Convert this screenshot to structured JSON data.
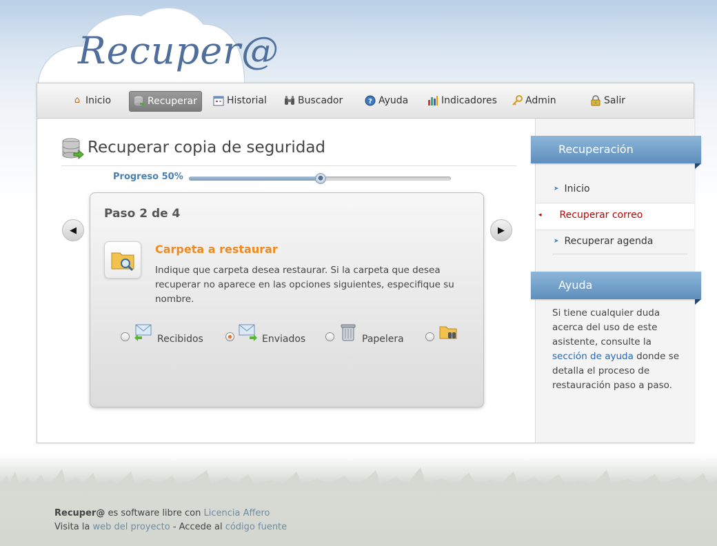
{
  "app": {
    "logo": "Recuper@"
  },
  "nav": {
    "items": [
      {
        "label": "Inicio",
        "icon": "home-icon"
      },
      {
        "label": "Recuperar",
        "icon": "database-icon"
      },
      {
        "label": "Historial",
        "icon": "calendar-icon"
      },
      {
        "label": "Buscador",
        "icon": "binoculars-icon"
      },
      {
        "label": "Ayuda",
        "icon": "help-icon"
      },
      {
        "label": "Indicadores",
        "icon": "bar-chart-icon"
      },
      {
        "label": "Admin",
        "icon": "key-icon"
      },
      {
        "label": "Salir",
        "icon": "lock-icon"
      }
    ],
    "active": "Recuperar"
  },
  "main": {
    "title": "Recuperar copia de seguridad",
    "progress": {
      "label": "Progreso 50%",
      "percent": 50
    },
    "step": {
      "counter": "Paso 2 de 4",
      "section_title": "Carpeta a restaurar",
      "description": "Indique que carpeta desea restaurar. Si la carpeta que desea recuperar no aparece en las opciones siguientes, especifique su nombre.",
      "options": [
        {
          "label": "Recibidos",
          "icon": "inbox-mail-icon",
          "selected": false
        },
        {
          "label": "Enviados",
          "icon": "sent-mail-icon",
          "selected": true
        },
        {
          "label": "Papelera",
          "icon": "trash-icon",
          "selected": false
        },
        {
          "label": "",
          "icon": "folder-search-icon",
          "selected": false
        }
      ]
    }
  },
  "sidebar": {
    "recovery_title": "Recuperación",
    "links": [
      {
        "label": "Inicio"
      },
      {
        "label": "Recuperar correo",
        "active": true
      },
      {
        "label": "Recuperar agenda"
      }
    ],
    "help_title": "Ayuda",
    "help_pre": "Si tiene cualquier duda acerca del uso de este asistente, consulte la ",
    "help_link": "sección de ayuda",
    "help_post": " donde se detalla el proceso de restauración paso a paso."
  },
  "footer": {
    "brand": "Recuper@",
    "line1_text": " es software libre con ",
    "license_link": "Licencia Affero",
    "line2_pre": "Visita la ",
    "project_link": "web del proyecto",
    "line2_mid": " - Accede al ",
    "source_link": "código fuente"
  },
  "colors": {
    "accent": "#f08a1c",
    "sidebar_header": "#6f9cc7",
    "active_link": "#c00000",
    "link": "#2a66b3"
  }
}
